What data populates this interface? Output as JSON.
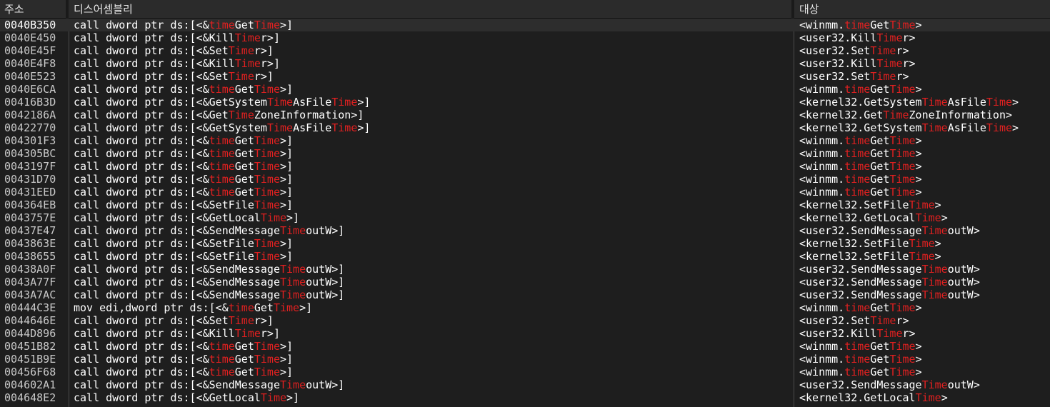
{
  "headers": {
    "address": "주소",
    "disassembly": "디스어셈블리",
    "target": "대상"
  },
  "colors": {
    "background": "#1e1e1e",
    "highlight": "#e02020",
    "text": "#ffffff"
  },
  "rows": [
    {
      "address": "0040B350",
      "disassembly": "call dword ptr ds:[<&timeGetTime>]",
      "target": "<winmm.timeGetTime>",
      "selected": true
    },
    {
      "address": "0040E450",
      "disassembly": "call dword ptr ds:[<&KillTimer>]",
      "target": "<user32.KillTimer>"
    },
    {
      "address": "0040E45F",
      "disassembly": "call dword ptr ds:[<&SetTimer>]",
      "target": "<user32.SetTimer>"
    },
    {
      "address": "0040E4F8",
      "disassembly": "call dword ptr ds:[<&KillTimer>]",
      "target": "<user32.KillTimer>"
    },
    {
      "address": "0040E523",
      "disassembly": "call dword ptr ds:[<&SetTimer>]",
      "target": "<user32.SetTimer>"
    },
    {
      "address": "0040E6CA",
      "disassembly": "call dword ptr ds:[<&timeGetTime>]",
      "target": "<winmm.timeGetTime>"
    },
    {
      "address": "00416B3D",
      "disassembly": "call dword ptr ds:[<&GetSystemTimeAsFileTime>]",
      "target": "<kernel32.GetSystemTimeAsFileTime>"
    },
    {
      "address": "0042186A",
      "disassembly": "call dword ptr ds:[<&GetTimeZoneInformation>]",
      "target": "<kernel32.GetTimeZoneInformation>"
    },
    {
      "address": "00422770",
      "disassembly": "call dword ptr ds:[<&GetSystemTimeAsFileTime>]",
      "target": "<kernel32.GetSystemTimeAsFileTime>"
    },
    {
      "address": "004301F3",
      "disassembly": "call dword ptr ds:[<&timeGetTime>]",
      "target": "<winmm.timeGetTime>"
    },
    {
      "address": "004305BC",
      "disassembly": "call dword ptr ds:[<&timeGetTime>]",
      "target": "<winmm.timeGetTime>"
    },
    {
      "address": "0043197F",
      "disassembly": "call dword ptr ds:[<&timeGetTime>]",
      "target": "<winmm.timeGetTime>"
    },
    {
      "address": "00431D70",
      "disassembly": "call dword ptr ds:[<&timeGetTime>]",
      "target": "<winmm.timeGetTime>"
    },
    {
      "address": "00431EED",
      "disassembly": "call dword ptr ds:[<&timeGetTime>]",
      "target": "<winmm.timeGetTime>"
    },
    {
      "address": "004364EB",
      "disassembly": "call dword ptr ds:[<&SetFileTime>]",
      "target": "<kernel32.SetFileTime>"
    },
    {
      "address": "0043757E",
      "disassembly": "call dword ptr ds:[<&GetLocalTime>]",
      "target": "<kernel32.GetLocalTime>"
    },
    {
      "address": "00437E47",
      "disassembly": "call dword ptr ds:[<&SendMessageTimeoutW>]",
      "target": "<user32.SendMessageTimeoutW>"
    },
    {
      "address": "0043863E",
      "disassembly": "call dword ptr ds:[<&SetFileTime>]",
      "target": "<kernel32.SetFileTime>"
    },
    {
      "address": "00438655",
      "disassembly": "call dword ptr ds:[<&SetFileTime>]",
      "target": "<kernel32.SetFileTime>"
    },
    {
      "address": "00438A0F",
      "disassembly": "call dword ptr ds:[<&SendMessageTimeoutW>]",
      "target": "<user32.SendMessageTimeoutW>"
    },
    {
      "address": "0043A77F",
      "disassembly": "call dword ptr ds:[<&SendMessageTimeoutW>]",
      "target": "<user32.SendMessageTimeoutW>"
    },
    {
      "address": "0043A7AC",
      "disassembly": "call dword ptr ds:[<&SendMessageTimeoutW>]",
      "target": "<user32.SendMessageTimeoutW>"
    },
    {
      "address": "00444C3E",
      "disassembly": "mov edi,dword ptr ds:[<&timeGetTime>]",
      "target": "<winmm.timeGetTime>"
    },
    {
      "address": "0044646E",
      "disassembly": "call dword ptr ds:[<&SetTimer>]",
      "target": "<user32.SetTimer>"
    },
    {
      "address": "0044D896",
      "disassembly": "call dword ptr ds:[<&KillTimer>]",
      "target": "<user32.KillTimer>"
    },
    {
      "address": "00451B82",
      "disassembly": "call dword ptr ds:[<&timeGetTime>]",
      "target": "<winmm.timeGetTime>"
    },
    {
      "address": "00451B9E",
      "disassembly": "call dword ptr ds:[<&timeGetTime>]",
      "target": "<winmm.timeGetTime>"
    },
    {
      "address": "00456F68",
      "disassembly": "call dword ptr ds:[<&timeGetTime>]",
      "target": "<winmm.timeGetTime>"
    },
    {
      "address": "004602A1",
      "disassembly": "call dword ptr ds:[<&SendMessageTimeoutW>]",
      "target": "<user32.SendMessageTimeoutW>"
    },
    {
      "address": "004648E2",
      "disassembly": "call dword ptr ds:[<&GetLocalTime>]",
      "target": "<kernel32.GetLocalTime>"
    }
  ]
}
